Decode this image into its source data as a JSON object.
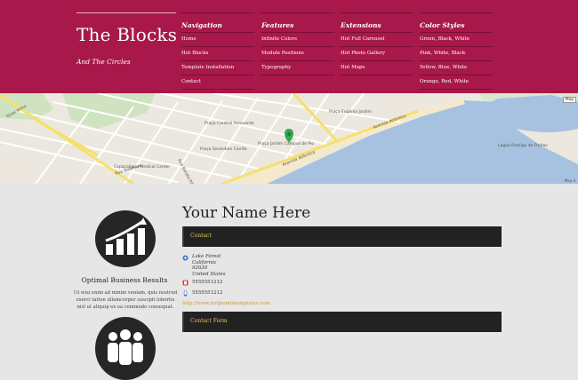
{
  "site": {
    "title": "The Blocks",
    "tagline": "And The Circles"
  },
  "menu": [
    {
      "heading": "Navigation",
      "items": [
        "Home",
        "Hot Blocks",
        "Template Installation",
        "Contact"
      ]
    },
    {
      "heading": "Features",
      "items": [
        "Infinite Colors",
        "Module Positions",
        "Typography"
      ]
    },
    {
      "heading": "Extensions",
      "items": [
        "Hot Full Carousel",
        "Hot Photo Gallery",
        "Hot Maps"
      ]
    },
    {
      "heading": "Color Styles",
      "items": [
        "Green, Black, White",
        "Pink, White, Black",
        "Yellow, Blue, White",
        "Orange, Red, White"
      ]
    }
  ],
  "map": {
    "button": "Map",
    "credit": "Map d",
    "labels": {
      "avenida_atlantica_1": "Avenida Atlântica",
      "avenida_atlantica_2": "Avenida Atlântica",
      "rua_toneleros": "Rua Toneleros",
      "medical_center": "Copacabana Medical Center",
      "praca_serzedelo": "Praça Serzedelo Corrêa",
      "praca_cardeal": "Praça Cardeal Arcoverde",
      "praca_eugenio": "Praça Eugênio Jardim",
      "tunel_velho": "Túnel Velho",
      "praca_campos": "Praça Jardim Campos de Pio",
      "rua_barata": "Rua Barata Ribeiro",
      "lagoa": "Lagoa Rodrigo de Freitas"
    }
  },
  "sidebar": {
    "title": "Optimal Business Results",
    "text": "Ut wisi enim ad minim veniam, quis nostrud exerci tation ullamcorper suscipit lobortis nisl ut aliquip ex ea commodo consequat."
  },
  "contact": {
    "title": "Your Name Here",
    "bar_label": "Contact",
    "address_line1": "Lake Forest",
    "address_line2": "California",
    "address_line3": "92630",
    "address_line4": "United States",
    "phone1": "5555551212",
    "phone2": "5555551212",
    "website": "http://www.hotjoomlatemplates.com",
    "form_label": "Contact Form"
  },
  "colors": {
    "header_bg": "#a8184a",
    "bar_bg": "#222222",
    "bar_text": "#e8c55e",
    "link": "#c89a2e"
  }
}
